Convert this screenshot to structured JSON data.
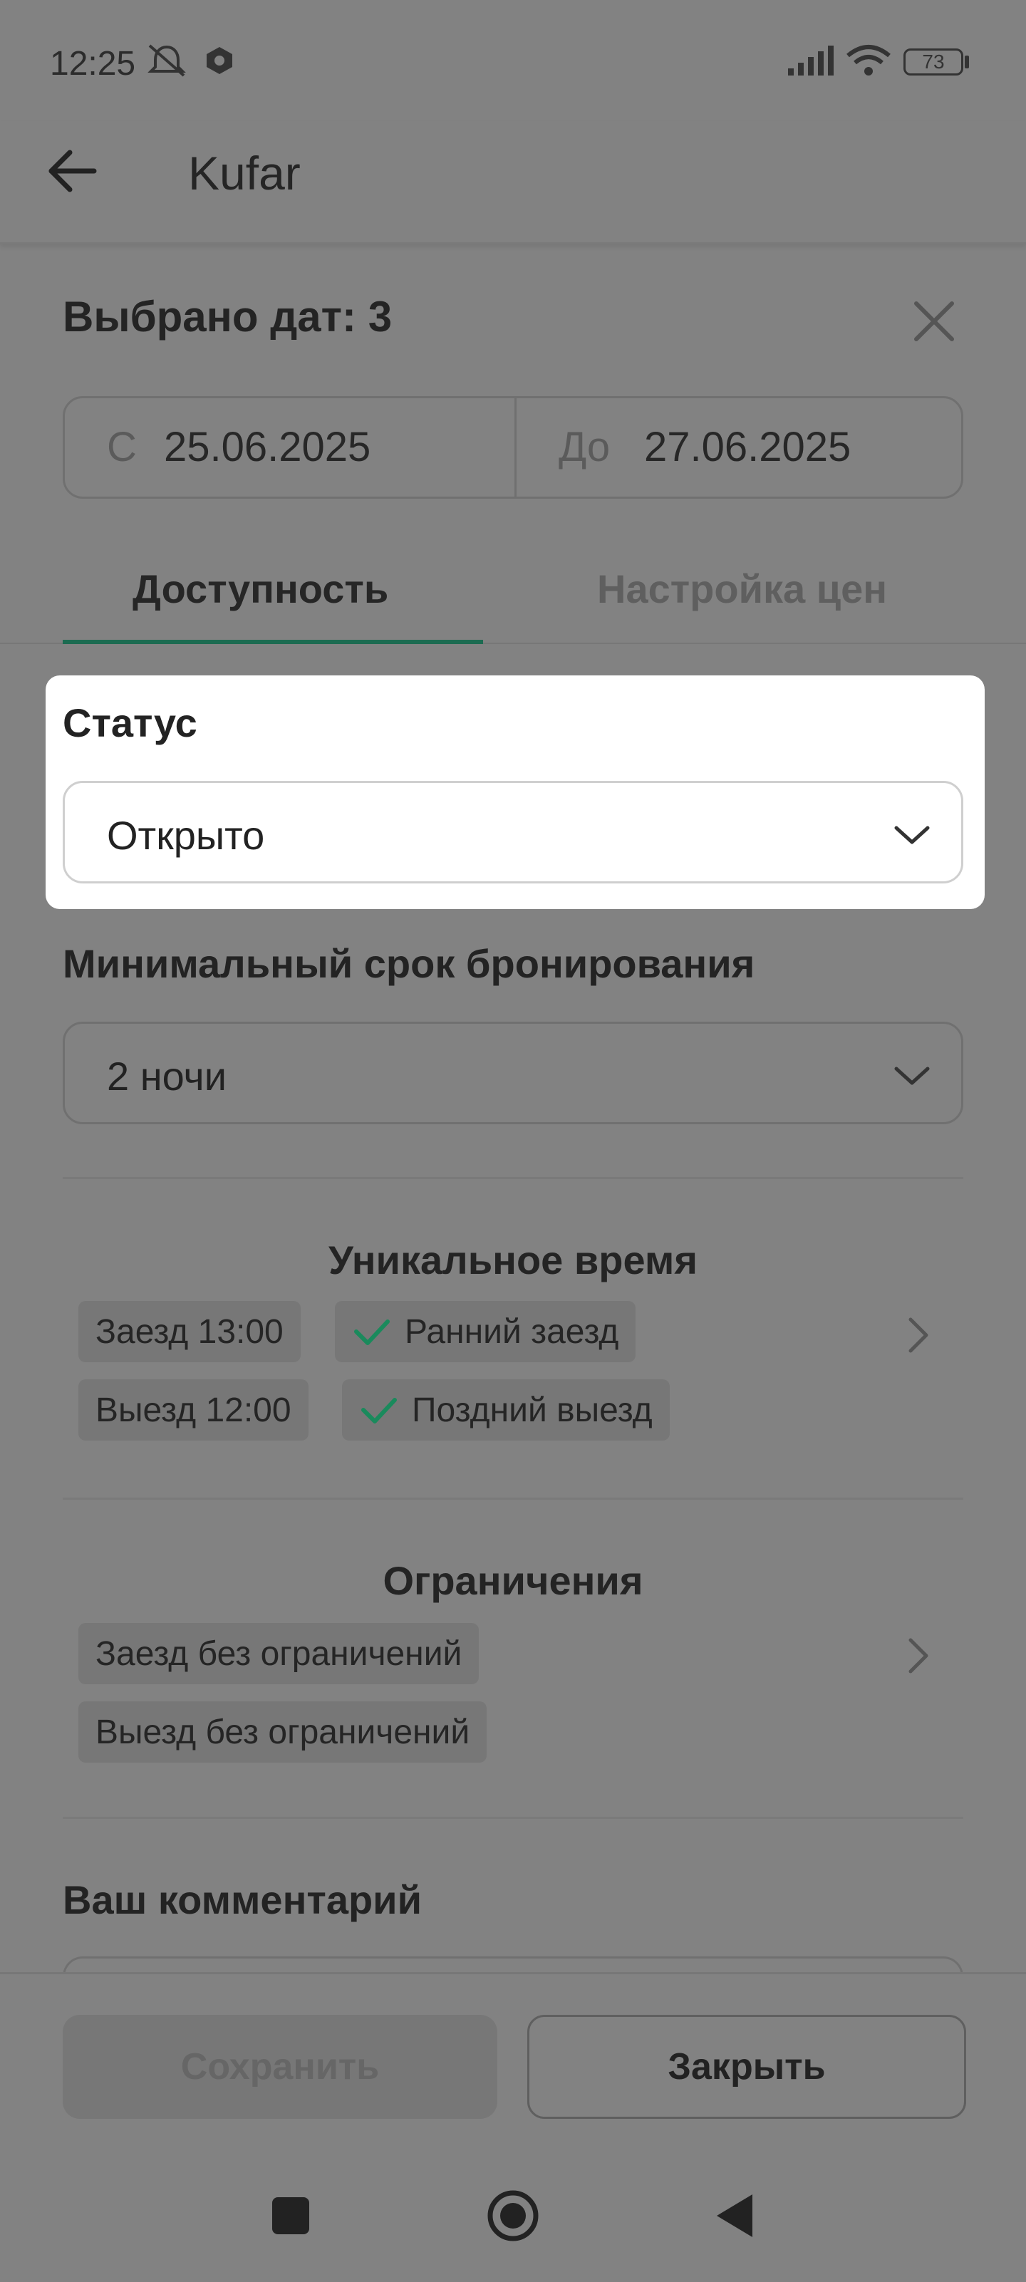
{
  "status_bar": {
    "time": "12:25",
    "battery": "73",
    "icons": [
      "mute-icon",
      "app-notification-icon",
      "signal-icon",
      "wifi-icon",
      "battery-icon"
    ]
  },
  "app_bar": {
    "title": "Kufar"
  },
  "dialog": {
    "title": "Выбрано дат: 3",
    "date_from_prefix": "С",
    "date_from": "25.06.2025",
    "date_to_prefix": "До",
    "date_to": "27.06.2025"
  },
  "tabs": [
    {
      "label": "Доступность",
      "active": true
    },
    {
      "label": "Настройка цен",
      "active": false
    }
  ],
  "status": {
    "label": "Статус",
    "value": "Открыто"
  },
  "min_stay": {
    "label": "Минимальный срок бронирования",
    "value": "2 ночи"
  },
  "unique_time": {
    "title": "Уникальное время",
    "checkin": "Заезд 13:00",
    "early_checkin": "Ранний заезд",
    "checkout": "Выезд 12:00",
    "late_checkout": "Поздний выезд"
  },
  "restrictions": {
    "title": "Ограничения",
    "checkin": "Заезд без ограничений",
    "checkout": "Выезд без ограничений"
  },
  "comment": {
    "label": "Ваш комментарий"
  },
  "footer": {
    "save_label": "Сохранить",
    "close_label": "Закрыть"
  },
  "colors": {
    "overlay_background": "#828282",
    "accent_green": "#1c6b51",
    "check_green": "#1a8a5c",
    "highlight_card": "#ffffff"
  }
}
